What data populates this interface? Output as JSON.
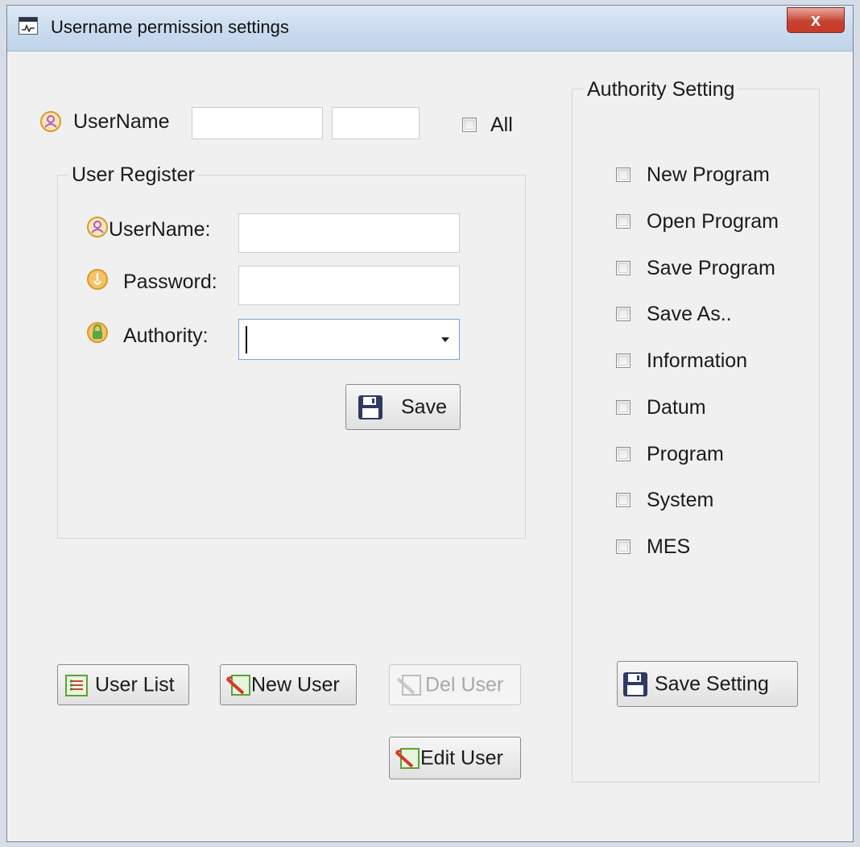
{
  "window": {
    "title": "Username permission settings",
    "close_label": "x"
  },
  "top": {
    "username_label": "UserName",
    "username_value_1": "",
    "username_value_2": "",
    "all_label": "All"
  },
  "register": {
    "group_title": "User Register",
    "username_label": "UserName:",
    "username_value": "",
    "password_label": "Password:",
    "password_value": "",
    "authority_label": "Authority:",
    "authority_value": "",
    "save_label": "Save"
  },
  "authority": {
    "group_title": "Authority Setting",
    "items": [
      {
        "label": "New Program",
        "checked": false
      },
      {
        "label": "Open Program",
        "checked": false
      },
      {
        "label": "Save Program",
        "checked": false
      },
      {
        "label": "Save As..",
        "checked": false
      },
      {
        "label": "Information",
        "checked": false
      },
      {
        "label": "Datum",
        "checked": false
      },
      {
        "label": "Program",
        "checked": false
      },
      {
        "label": "System",
        "checked": false
      },
      {
        "label": "MES",
        "checked": false
      }
    ],
    "save_setting_label": "Save Setting"
  },
  "buttons": {
    "user_list": "User List",
    "new_user": "New User",
    "del_user": "Del User",
    "edit_user": "Edit User"
  },
  "colors": {
    "user_icon": "#d39a2a",
    "password_icon": "#e8a33a",
    "authority_icon": "#56a844",
    "save_icon": "#2e3a62",
    "close_button": "#c5432f"
  }
}
